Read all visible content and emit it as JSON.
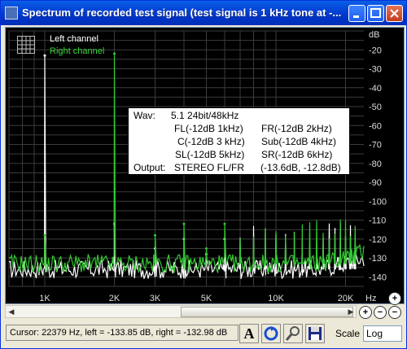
{
  "window": {
    "title": "Spectrum of recorded test signal (test signal is 1 kHz tone at -..."
  },
  "legend": {
    "left": "Left channel",
    "right": "Right channel"
  },
  "colors": {
    "left_trace": "#ffffff",
    "right_trace": "#32c832",
    "grid": "#3c3c3c",
    "background": "#000000"
  },
  "info_box": {
    "wav_label": "Wav:",
    "wav_value": "5.1 24bit/48kHz",
    "row1_a": "FL(-12dB  1kHz)",
    "row1_b": "FR(-12dB 2kHz)",
    "row2_a": "C(-12dB 3 kHz)",
    "row2_b": "Sub(-12dB 4kHz)",
    "row3_a": "SL(-12dB 5kHz)",
    "row3_b": "SR(-12dB 6kHz)",
    "output_label": "Output:",
    "output_value": "STEREO FL/FR",
    "output_db": "(-13.6dB, -12.8dB)"
  },
  "chart_data": {
    "type": "line",
    "xscale": "log",
    "xlim": [
      700,
      24000
    ],
    "ylim": [
      -145,
      -10
    ],
    "x_ticks": [
      {
        "v": 1000,
        "label": "1K"
      },
      {
        "v": 2000,
        "label": "2K"
      },
      {
        "v": 3000,
        "label": "3K"
      },
      {
        "v": 5000,
        "label": "5K"
      },
      {
        "v": 10000,
        "label": "10K"
      },
      {
        "v": 20000,
        "label": "20K"
      }
    ],
    "x_unit": "Hz",
    "y_unit": "dB",
    "y_ticks": [
      -20,
      -30,
      -40,
      -50,
      -60,
      -70,
      -80,
      -90,
      -100,
      -110,
      -120,
      -130,
      -140
    ],
    "grid": true,
    "legend_position": "top-left",
    "series": [
      {
        "name": "Left channel",
        "peaks": [
          {
            "x": 1000,
            "y": -23
          },
          {
            "x": 2000,
            "y": -112
          },
          {
            "x": 3000,
            "y": -125
          },
          {
            "x": 4000,
            "y": -120
          },
          {
            "x": 5000,
            "y": -128
          },
          {
            "x": 6000,
            "y": -120
          }
        ],
        "floor": -136
      },
      {
        "name": "Right channel",
        "peaks": [
          {
            "x": 1000,
            "y": -118
          },
          {
            "x": 2000,
            "y": -22
          },
          {
            "x": 3000,
            "y": -118
          },
          {
            "x": 4000,
            "y": -112
          },
          {
            "x": 5000,
            "y": -125
          },
          {
            "x": 6000,
            "y": -112
          }
        ],
        "floor": -133
      }
    ]
  },
  "status": {
    "cursor": "Cursor:  22379 Hz,  left = -133.85 dB,  right = -132.98 dB"
  },
  "scale": {
    "label": "Scale",
    "value": "Log"
  },
  "icons": {
    "zoom_in": "+",
    "zoom_out": "−",
    "font": "A"
  }
}
